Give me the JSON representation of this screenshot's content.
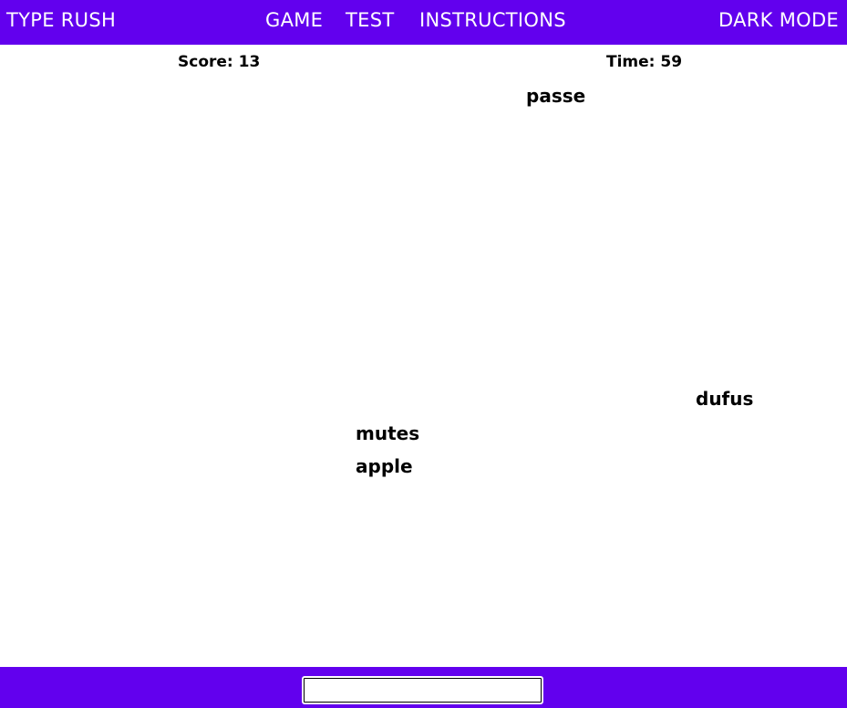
{
  "header": {
    "brand": "TYPE RUSH",
    "nav": {
      "game": "GAME",
      "test": "TEST",
      "instructions": "INSTRUCTIONS"
    },
    "dark_mode": "DARK MODE"
  },
  "hud": {
    "score": "Score: 13",
    "time": "Time: 59"
  },
  "words": {
    "passe": "passe",
    "dufus": "dufus",
    "mutes": "mutes",
    "apple": "apple"
  },
  "input": {
    "value": "",
    "placeholder": ""
  },
  "colors": {
    "accent": "#6200ee",
    "background": "#ffffff",
    "text": "#000000"
  }
}
